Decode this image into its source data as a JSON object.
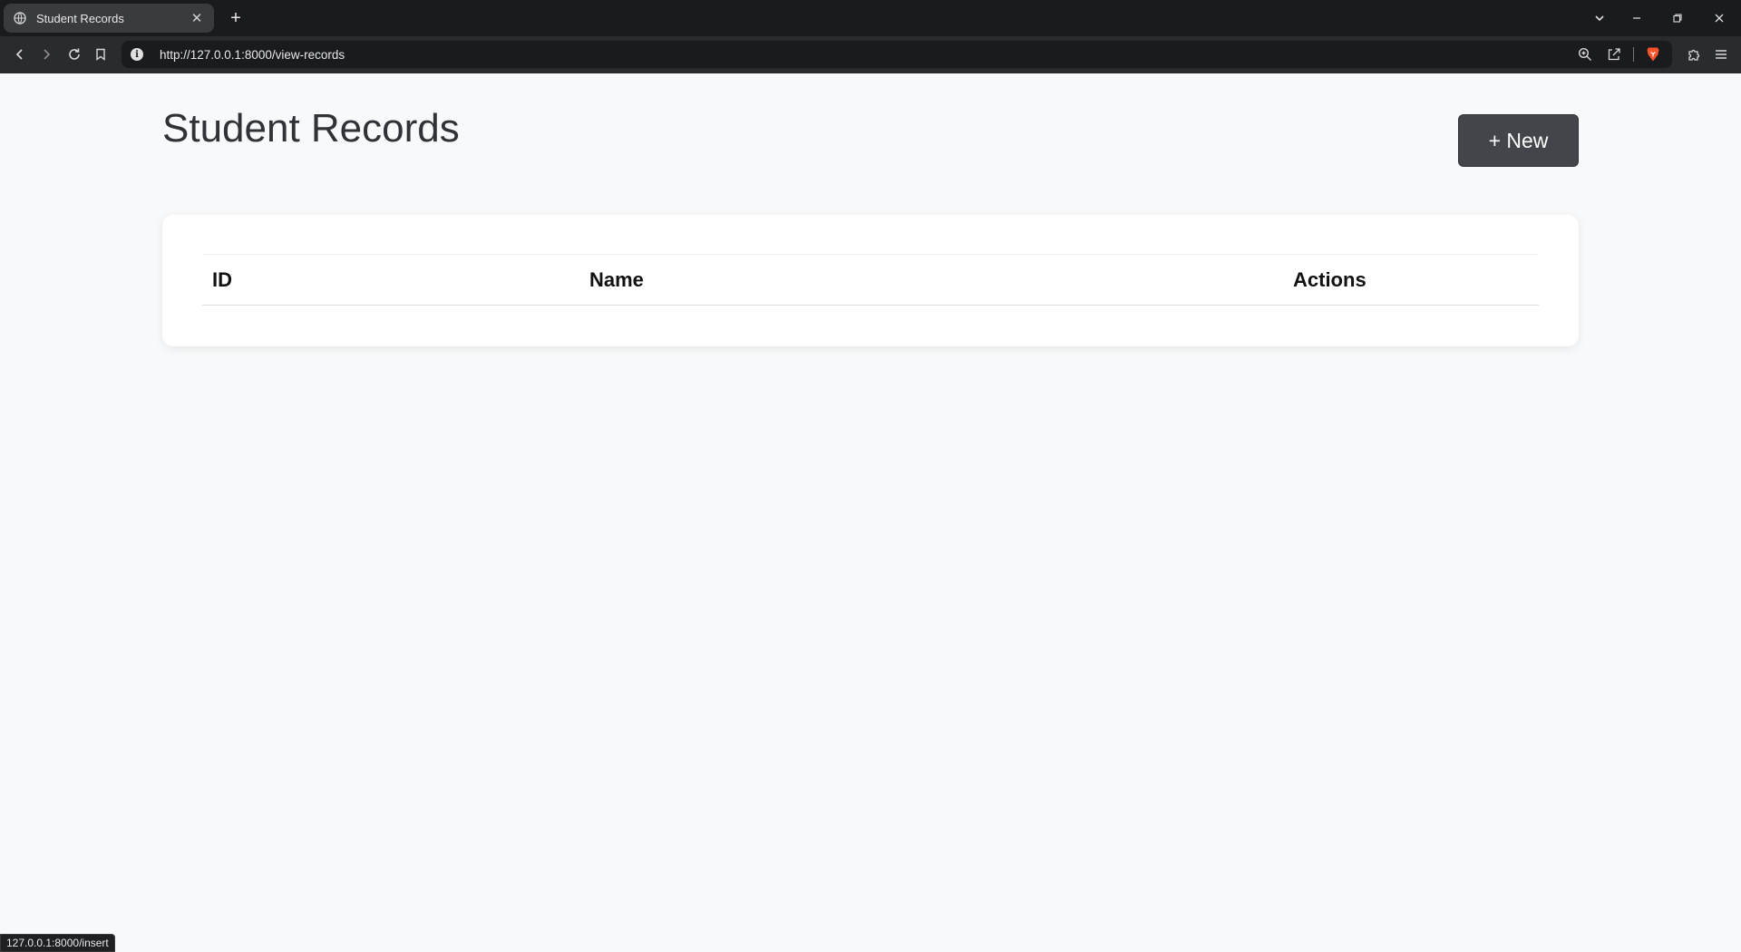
{
  "browser": {
    "tab_title": "Student Records",
    "url": "http://127.0.0.1:8000/view-records",
    "status_url": "127.0.0.1:8000/insert"
  },
  "page": {
    "title": "Student Records",
    "new_button_label": "+ New",
    "table": {
      "columns": [
        "ID",
        "Name",
        "Actions"
      ],
      "rows": []
    }
  },
  "icons": {
    "tab_favicon": "globe-icon",
    "brand": "brave-lion-icon",
    "brand_color": "#fb542b"
  }
}
